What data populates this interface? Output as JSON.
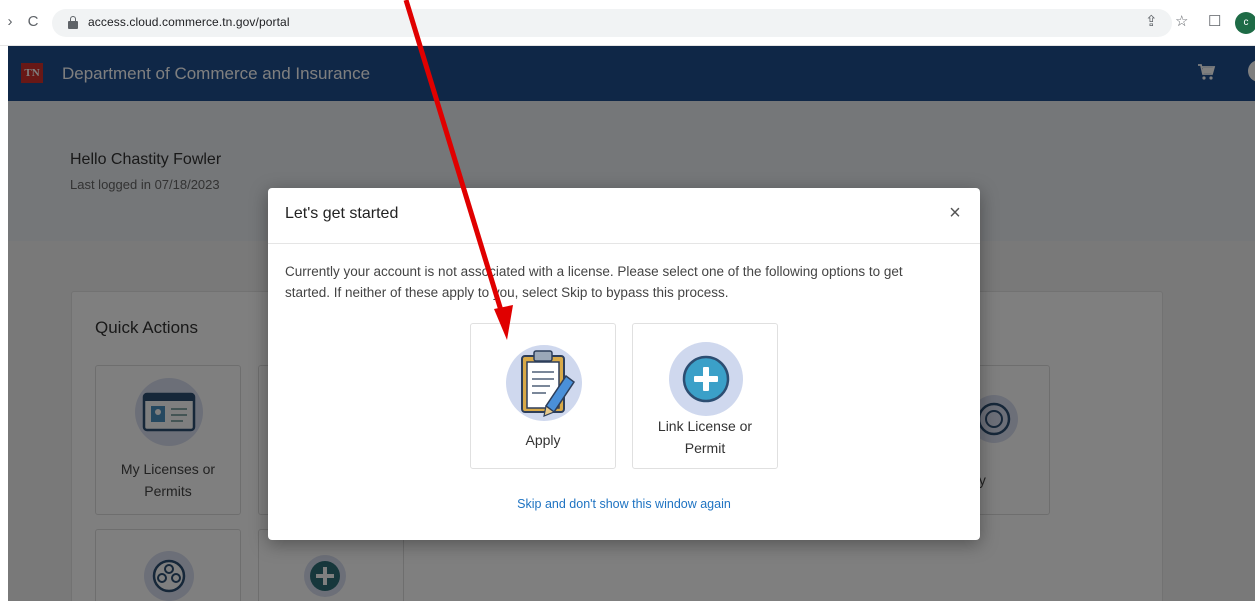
{
  "browser": {
    "url": "access.cloud.commerce.tn.gov/portal",
    "profile_initial": "c"
  },
  "header": {
    "logo_text": "TN",
    "title": "Department of Commerce and Insurance",
    "colors": {
      "bar": "#1f4e8f",
      "logo": "#d0312d"
    }
  },
  "welcome": {
    "greeting": "Hello Chastity Fowler",
    "last_logged": "Last logged in 07/18/2023"
  },
  "quick_actions": {
    "title": "Quick Actions",
    "tiles": [
      {
        "label_line1": "My Licenses or",
        "label_line2": "Permits",
        "icon": "id-card-icon"
      },
      {
        "label": "fy",
        "icon": "verify-icon"
      },
      {
        "icon": "reel-icon"
      },
      {
        "icon": "add-icon"
      }
    ]
  },
  "modal": {
    "title": "Let's get started",
    "close_label": "×",
    "description": "Currently your account is not associated with a license. Please select one of the following options to get started. If neither of these apply to you, select Skip to bypass this process.",
    "options": [
      {
        "label": "Apply",
        "icon": "clipboard-pencil-icon"
      },
      {
        "label_line1": "Link License or",
        "label_line2": "Permit",
        "icon": "plus-circle-icon"
      }
    ],
    "skip_label": "Skip and don't show this window again",
    "colors": {
      "link": "#1e73c2",
      "icon_circle": "#cfd8ee",
      "plus_fill": "#3ba0c8"
    }
  },
  "annotation": {
    "arrow_color": "#e00000"
  }
}
